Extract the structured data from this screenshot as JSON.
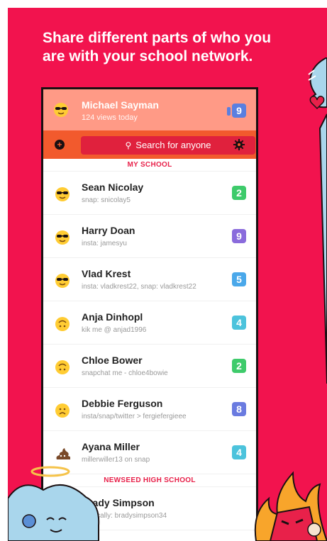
{
  "headline": {
    "line1": "Share different parts of who you",
    "line2": "are with your school network."
  },
  "profile": {
    "name": "Michael Sayman",
    "subtitle": "124 views today",
    "badge": "9",
    "badge_color": "#5a7fe0",
    "emoji": "sunglasses-emoji"
  },
  "search": {
    "placeholder": "Search for anyone",
    "add_icon": "plus-circle-icon",
    "settings_icon": "gear-icon"
  },
  "sections": {
    "my_school": "MY SCHOOL",
    "other_school": "NEWSEED HIGH SCHOOL"
  },
  "people": [
    {
      "name": "Sean Nicolay",
      "sub": "snap: snicolay5",
      "badge": "2",
      "color": "#3ecb6b",
      "emoji": "sunglasses"
    },
    {
      "name": "Harry Doan",
      "sub": "insta: jamesyu",
      "badge": "9",
      "color": "#8a6bdc",
      "emoji": "sunglasses"
    },
    {
      "name": "Vlad Krest",
      "sub": "insta: vladkrest22, snap: vladkrest22",
      "badge": "5",
      "color": "#4aa8ea",
      "emoji": "sunglasses"
    },
    {
      "name": "Anja Dinhopl",
      "sub": "kik me @ anjad1996",
      "badge": "4",
      "color": "#4cc3dc",
      "emoji": "upside-down"
    },
    {
      "name": "Chloe Bower",
      "sub": "snapchat me - chloe4bowie",
      "badge": "2",
      "color": "#3ecb6b",
      "emoji": "upside-down"
    },
    {
      "name": "Debbie Ferguson",
      "sub": "insta/snap/twitter > fergiefergieee",
      "badge": "8",
      "color": "#6a7be0",
      "emoji": "sad"
    },
    {
      "name": "Ayana Miller",
      "sub": "millerwiller13 on snap",
      "badge": "4",
      "color": "#4cc3dc",
      "emoji": "poop"
    }
  ],
  "other_people": [
    {
      "name": "Brady Simpson",
      "sub": "musically: bradysimpson34"
    }
  ]
}
